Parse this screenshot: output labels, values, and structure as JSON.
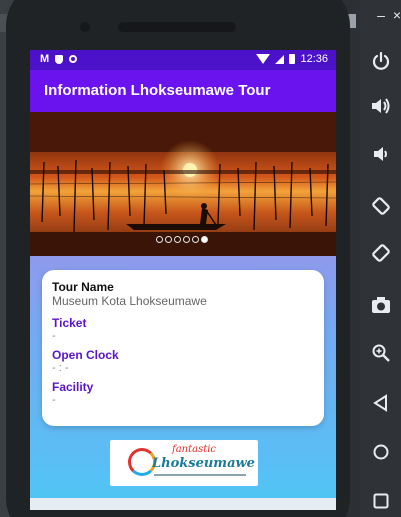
{
  "status_bar": {
    "time": "12:36",
    "mail_icon": "gmail-icon"
  },
  "app_bar": {
    "title": "Information Lhokseumawe Tour"
  },
  "slider": {
    "dots": 6,
    "active_index": 5
  },
  "card": {
    "tour_name_label": "Tour Name",
    "tour_name_value": "Museum Kota Lhokseumawe",
    "ticket_label": "Ticket",
    "ticket_value": "-",
    "open_clock_label": "Open Clock",
    "open_clock_value": "- : -",
    "facility_label": "Facility",
    "facility_value": "-"
  },
  "logo": {
    "line1": "fantastic",
    "line2": "Lhokseumawe"
  },
  "emulator_toolbar": {
    "minimize": "–",
    "close": "×",
    "icons": [
      "power-icon",
      "volume-up-icon",
      "volume-down-icon",
      "rotate-left-icon",
      "rotate-right-icon",
      "camera-icon",
      "zoom-icon",
      "back-icon",
      "home-icon",
      "overview-icon"
    ]
  },
  "colors": {
    "status_bar": "#4b12c9",
    "app_bar": "#6b13ef",
    "accent_label": "#5a14c9"
  }
}
